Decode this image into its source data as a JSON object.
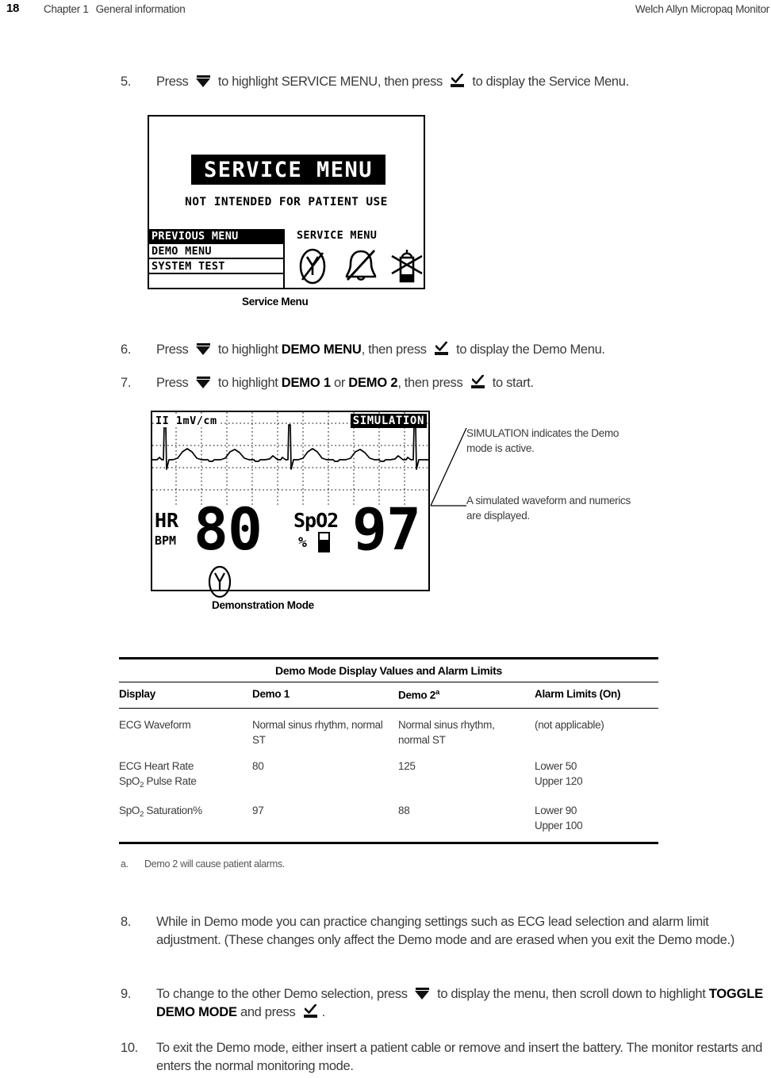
{
  "header": {
    "page_number": "18",
    "chapter": "Chapter 1",
    "section": "General information",
    "doc_title": "Welch Allyn Micropaq Monitor"
  },
  "steps": [
    {
      "number": "5.",
      "parts": [
        {
          "t": "text",
          "v": "Press "
        },
        {
          "t": "icon",
          "v": "down-arrow-key-icon"
        },
        {
          "t": "text",
          "v": " to highlight SERVICE MENU, then press "
        },
        {
          "t": "icon",
          "v": "check-key-icon"
        },
        {
          "t": "text",
          "v": " to display the Service Menu."
        }
      ]
    },
    {
      "number": "6.",
      "parts": [
        {
          "t": "text",
          "v": "Press "
        },
        {
          "t": "icon",
          "v": "down-arrow-key-icon"
        },
        {
          "t": "text",
          "v": " to highlight "
        },
        {
          "t": "bold",
          "v": "DEMO MENU"
        },
        {
          "t": "text",
          "v": ", then press "
        },
        {
          "t": "icon",
          "v": "check-key-icon"
        },
        {
          "t": "text",
          "v": " to display the Demo Menu."
        }
      ]
    },
    {
      "number": "7.",
      "parts": [
        {
          "t": "text",
          "v": "Press "
        },
        {
          "t": "icon",
          "v": "down-arrow-key-icon"
        },
        {
          "t": "text",
          "v": " to highlight "
        },
        {
          "t": "bold",
          "v": "DEMO 1"
        },
        {
          "t": "text",
          "v": " or "
        },
        {
          "t": "bold",
          "v": "DEMO 2"
        },
        {
          "t": "text",
          "v": ", then press "
        },
        {
          "t": "icon",
          "v": "check-key-icon"
        },
        {
          "t": "text",
          "v": " to start."
        }
      ]
    },
    {
      "number": "8.",
      "parts": [
        {
          "t": "text",
          "v": "While in Demo mode you can practice changing settings such as ECG lead selection and alarm limit adjustment. (These changes only affect the Demo mode and are erased when you exit the Demo mode.)"
        }
      ]
    },
    {
      "number": "9.",
      "parts": [
        {
          "t": "text",
          "v": "To change to the other Demo selection, press "
        },
        {
          "t": "icon",
          "v": "down-arrow-key-icon"
        },
        {
          "t": "text",
          "v": " to display the menu, then scroll down to highlight "
        },
        {
          "t": "bold",
          "v": "TOGGLE DEMO MODE"
        },
        {
          "t": "text",
          "v": " and press "
        },
        {
          "t": "icon",
          "v": "check-key-icon"
        },
        {
          "t": "text",
          "v": "."
        }
      ]
    },
    {
      "number": "10.",
      "parts": [
        {
          "t": "text",
          "v": "To exit the Demo mode, either insert a patient cable or remove and insert the battery. The monitor restarts and enters the normal monitoring mode."
        }
      ]
    }
  ],
  "service_screen": {
    "caption": "Service Menu",
    "title": "SERVICE MENU",
    "subtitle": "NOT INTENDED FOR PATIENT USE",
    "menu_items": [
      {
        "label": "PREVIOUS MENU",
        "selected": true
      },
      {
        "label": "DEMO MENU",
        "selected": false
      },
      {
        "label": "SYSTEM TEST",
        "selected": false
      },
      {
        "label": "",
        "selected": false
      }
    ],
    "right_label": "SERVICE MENU",
    "status_icons": [
      "ecg-lead-off-icon",
      "alarm-bell-off-icon",
      "patient-off-icon"
    ]
  },
  "demo_screen": {
    "caption": "Demonstration Mode",
    "lead_label": "II  1mV/cm",
    "simulation_badge": "SIMULATION",
    "hr_label": "HR",
    "hr_units": "BPM",
    "hr_value": "80",
    "spo2_label": "SpO2",
    "spo2_percent_symbol": "%",
    "spo2_value": "97",
    "lead_icon": "ecg-lead-icon",
    "callouts": [
      "SIMULATION indicates the Demo mode is active.",
      "A simulated waveform and numerics are displayed."
    ]
  },
  "table": {
    "title": "Demo Mode Display Values and Alarm Limits",
    "columns": [
      "Display",
      "Demo 1",
      "Demo 2",
      "Alarm Limits (On)"
    ],
    "column_3_superscript": "a",
    "rows": [
      {
        "display": "ECG Waveform",
        "demo1": "Normal sinus rhythm, normal ST",
        "demo2": "Normal sinus rhythm, normal ST",
        "limits": "(not applicable)"
      },
      {
        "display_line1": "ECG Heart Rate",
        "display_line2_pre": "SpO",
        "display_line2_sub": "2",
        "display_line2_post": " Pulse Rate",
        "demo1": "80",
        "demo2": "125",
        "limits_line1": "Lower 50",
        "limits_line2": "Upper 120"
      },
      {
        "display_pre": "SpO",
        "display_sub": "2",
        "display_post": " Saturation%",
        "demo1": "97",
        "demo2": "88",
        "limits_line1": "Lower 90",
        "limits_line2": "Upper 100"
      }
    ],
    "footnote_mark": "a.",
    "footnote_text": "Demo 2 will cause patient alarms."
  }
}
